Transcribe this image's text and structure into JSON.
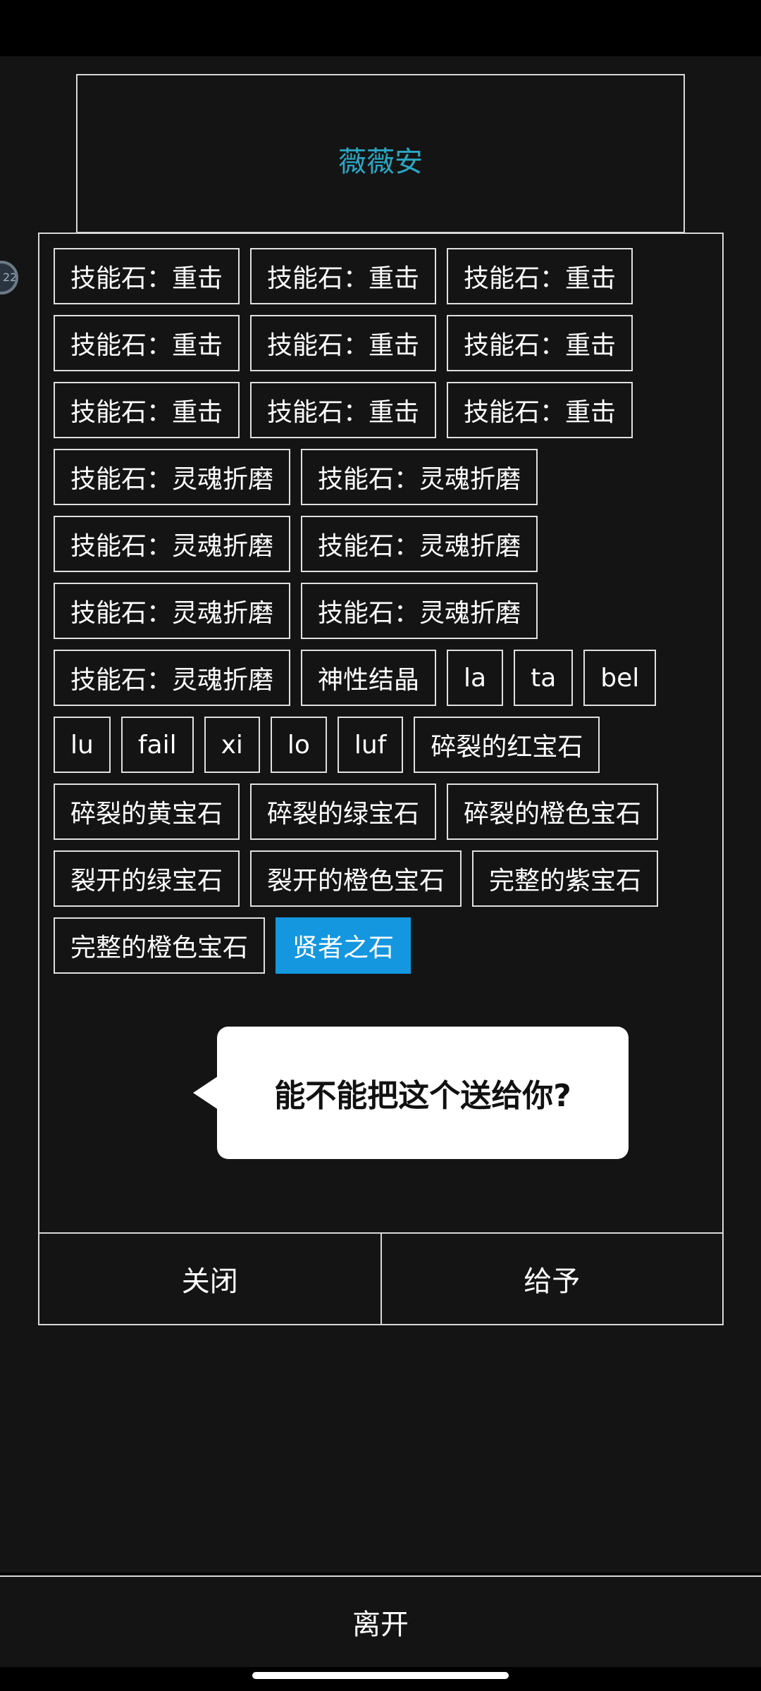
{
  "npc": {
    "name": "薇薇安"
  },
  "avatar": {
    "label": "22"
  },
  "items": [
    {
      "label": "技能石：重击",
      "selected": false
    },
    {
      "label": "技能石：重击",
      "selected": false
    },
    {
      "label": "技能石：重击",
      "selected": false
    },
    {
      "label": "技能石：重击",
      "selected": false
    },
    {
      "label": "技能石：重击",
      "selected": false
    },
    {
      "label": "技能石：重击",
      "selected": false
    },
    {
      "label": "技能石：重击",
      "selected": false
    },
    {
      "label": "技能石：重击",
      "selected": false
    },
    {
      "label": "技能石：重击",
      "selected": false
    },
    {
      "label": "技能石：灵魂折磨",
      "selected": false
    },
    {
      "label": "技能石：灵魂折磨",
      "selected": false
    },
    {
      "label": "技能石：灵魂折磨",
      "selected": false
    },
    {
      "label": "技能石：灵魂折磨",
      "selected": false
    },
    {
      "label": "技能石：灵魂折磨",
      "selected": false
    },
    {
      "label": "技能石：灵魂折磨",
      "selected": false
    },
    {
      "label": "技能石：灵魂折磨",
      "selected": false
    },
    {
      "label": "神性结晶",
      "selected": false
    },
    {
      "label": "la",
      "selected": false
    },
    {
      "label": "ta",
      "selected": false
    },
    {
      "label": "bel",
      "selected": false
    },
    {
      "label": "lu",
      "selected": false
    },
    {
      "label": "fail",
      "selected": false
    },
    {
      "label": "xi",
      "selected": false
    },
    {
      "label": "lo",
      "selected": false
    },
    {
      "label": "luf",
      "selected": false
    },
    {
      "label": "碎裂的红宝石",
      "selected": false
    },
    {
      "label": "碎裂的黄宝石",
      "selected": false
    },
    {
      "label": "碎裂的绿宝石",
      "selected": false
    },
    {
      "label": "碎裂的橙色宝石",
      "selected": false
    },
    {
      "label": "裂开的绿宝石",
      "selected": false
    },
    {
      "label": "裂开的橙色宝石",
      "selected": false
    },
    {
      "label": "完整的紫宝石",
      "selected": false
    },
    {
      "label": "完整的橙色宝石",
      "selected": false
    },
    {
      "label": "贤者之石",
      "selected": true
    }
  ],
  "dialog": {
    "text": "能不能把这个送给你?"
  },
  "actions": {
    "close_label": "关闭",
    "give_label": "给予"
  },
  "footer": {
    "leave_label": "离开"
  },
  "colors": {
    "accent": "#1597e0",
    "npc_name": "#2aa7c4",
    "background": "#141414"
  }
}
